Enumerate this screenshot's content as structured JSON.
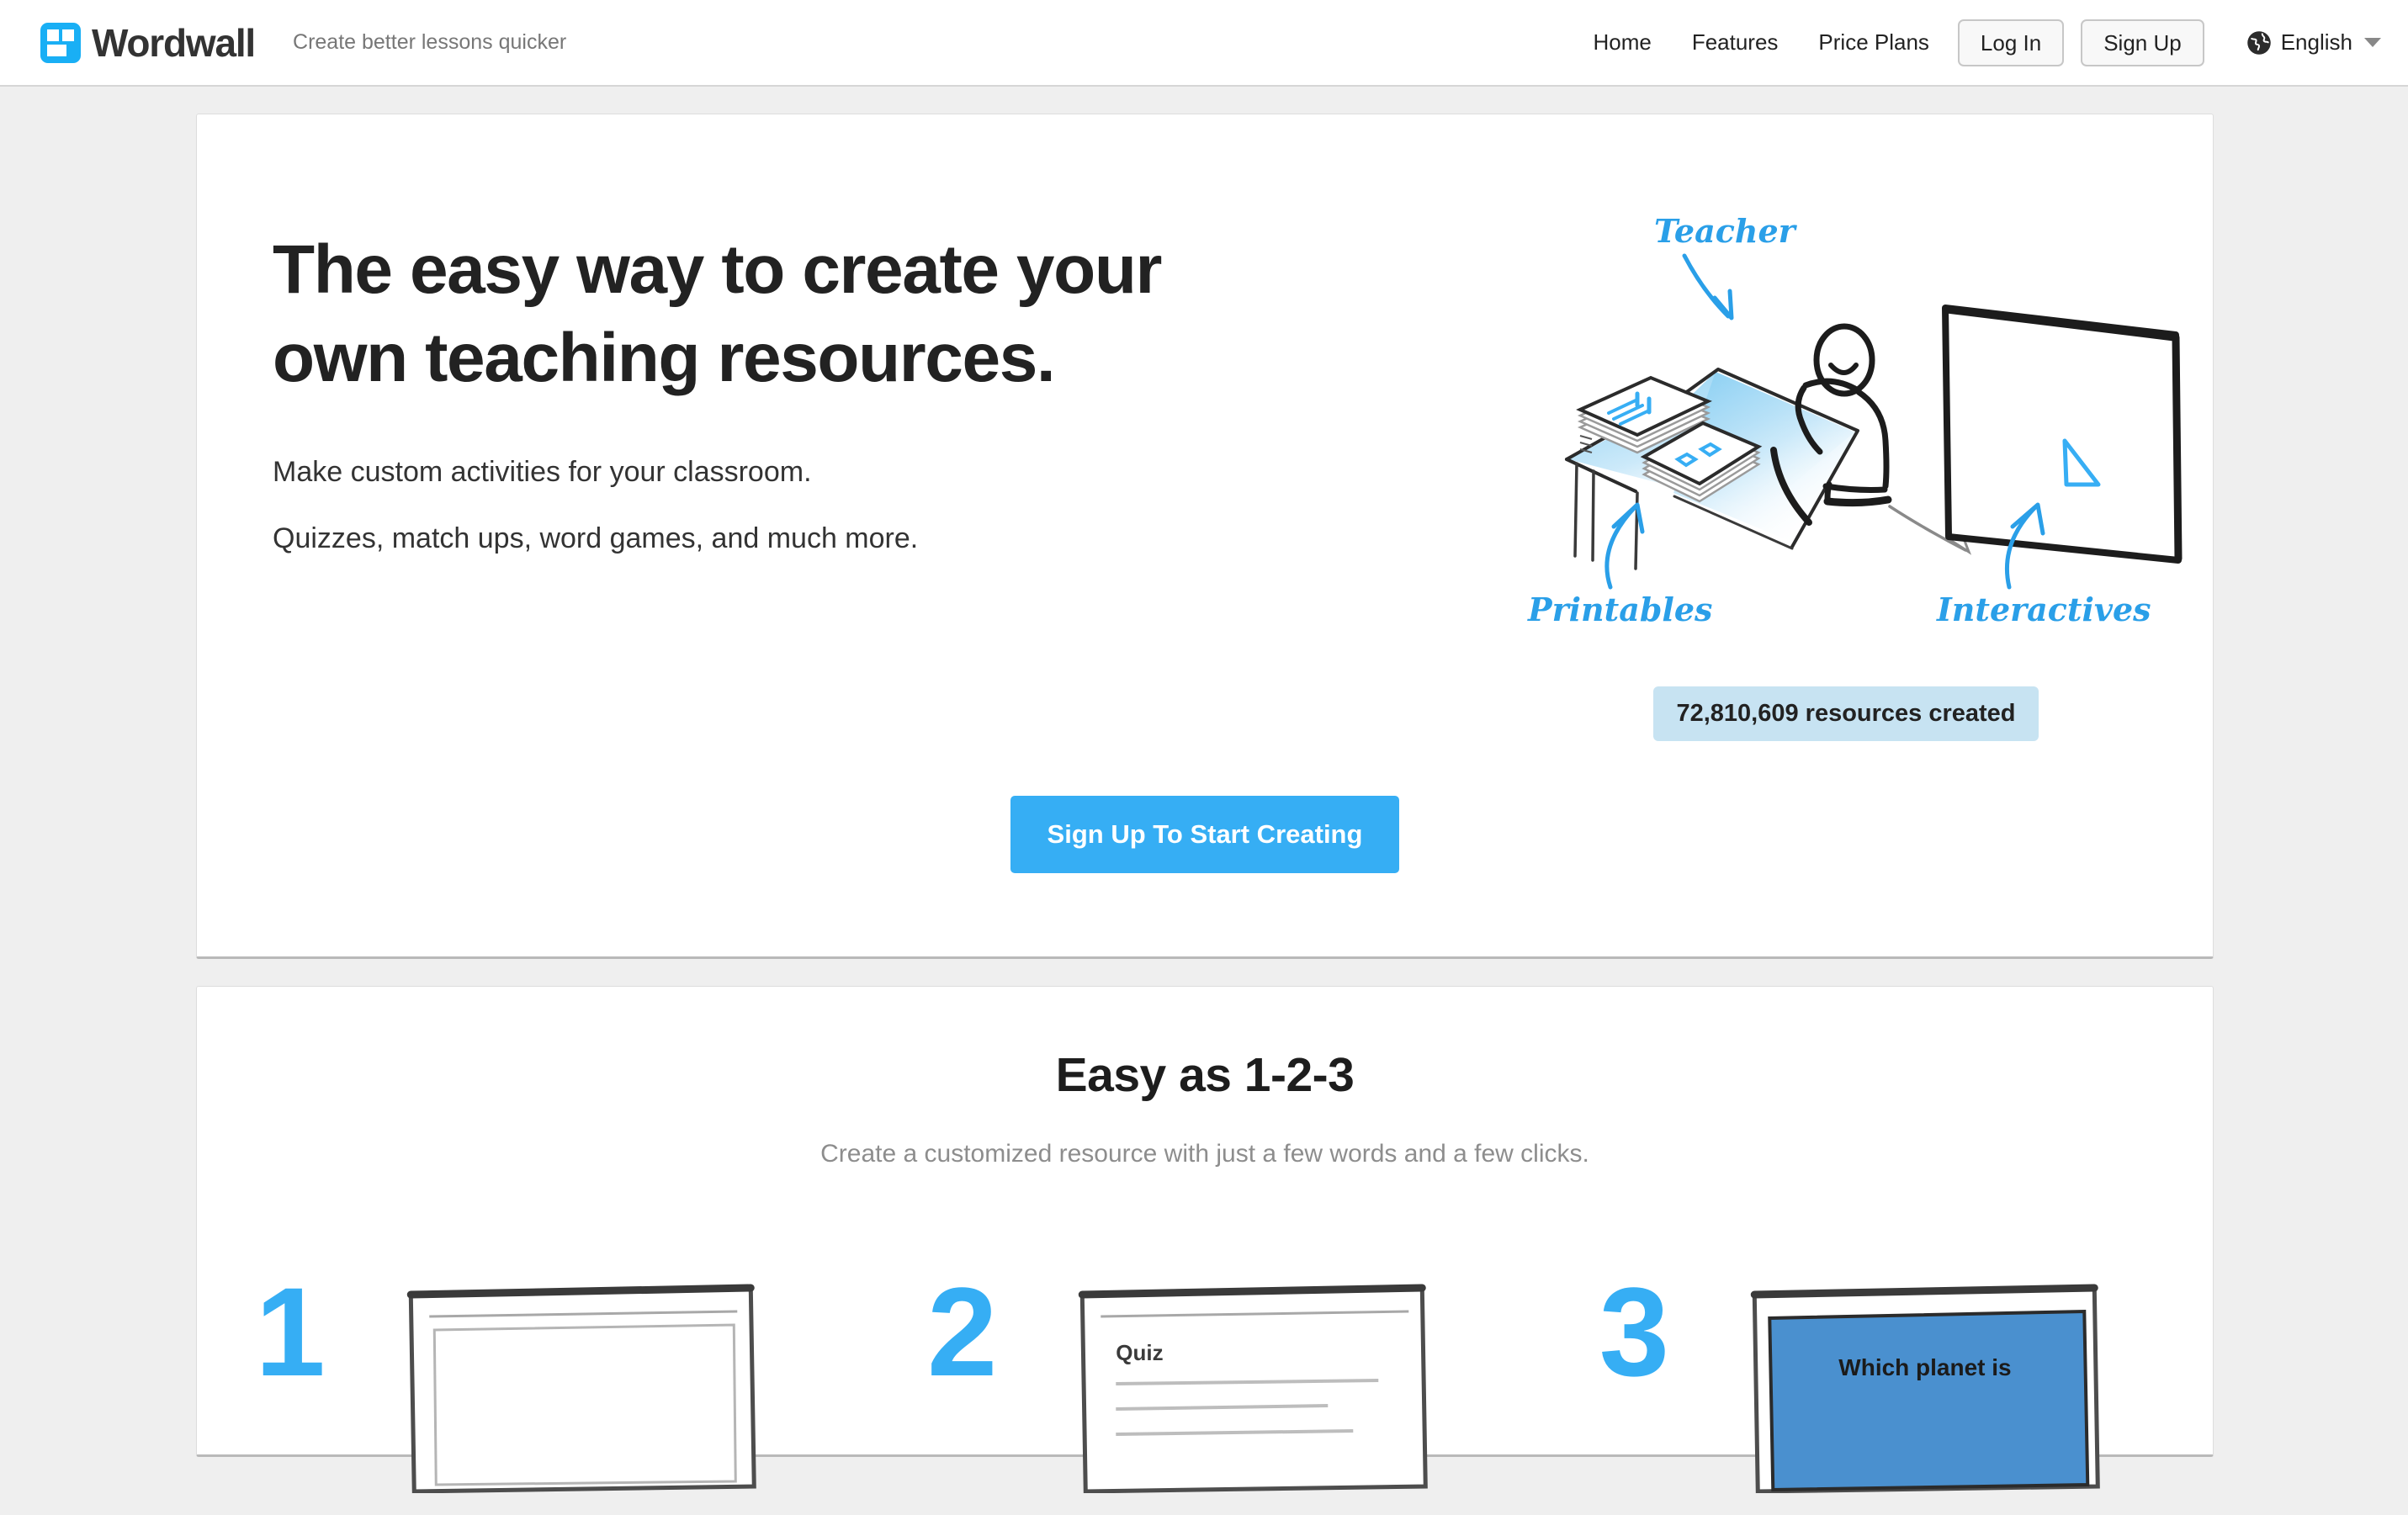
{
  "header": {
    "brand_name": "Wordwall",
    "brand_mark_icon": "wordwall-grid-logo-icon",
    "tagline": "Create better lessons quicker",
    "nav": [
      {
        "label": "Home",
        "name": "nav-home"
      },
      {
        "label": "Features",
        "name": "nav-features"
      },
      {
        "label": "Price Plans",
        "name": "nav-price-plans"
      }
    ],
    "login_label": "Log In",
    "signup_label": "Sign Up",
    "language": {
      "icon": "globe-icon",
      "label": "English",
      "caret_icon": "chevron-down-icon"
    }
  },
  "hero": {
    "title_line1": "The easy way to create your",
    "title_line2": "own teaching resources.",
    "sub1": "Make custom activities for your classroom.",
    "sub2": "Quizzes, match ups, word games, and much more.",
    "cta_label": "Sign Up To Start Creating",
    "counter_label": "72,810,609 resources created",
    "illustration": {
      "name": "teacher-classroom-sketch-illustration",
      "labels": {
        "teacher": "Teacher",
        "printables": "Printables",
        "interactives": "Interactives"
      }
    }
  },
  "steps_section": {
    "title": "Easy as 1-2-3",
    "subtitle": "Create a customized resource with just a few words and a few clicks.",
    "steps": [
      {
        "number": "1",
        "thumb": "blank-template-sketch"
      },
      {
        "number": "2",
        "thumb": "quiz-content-sketch",
        "thumb_text": "Quiz"
      },
      {
        "number": "3",
        "thumb": "blue-activity-sketch",
        "thumb_text": "Which planet is"
      }
    ]
  },
  "colors": {
    "accent": "#36AEF4",
    "page_background": "#efefef",
    "card_background": "#ffffff",
    "counter_background": "#c7e3f2",
    "text_primary": "#222222",
    "text_muted": "#8d8d8d"
  }
}
